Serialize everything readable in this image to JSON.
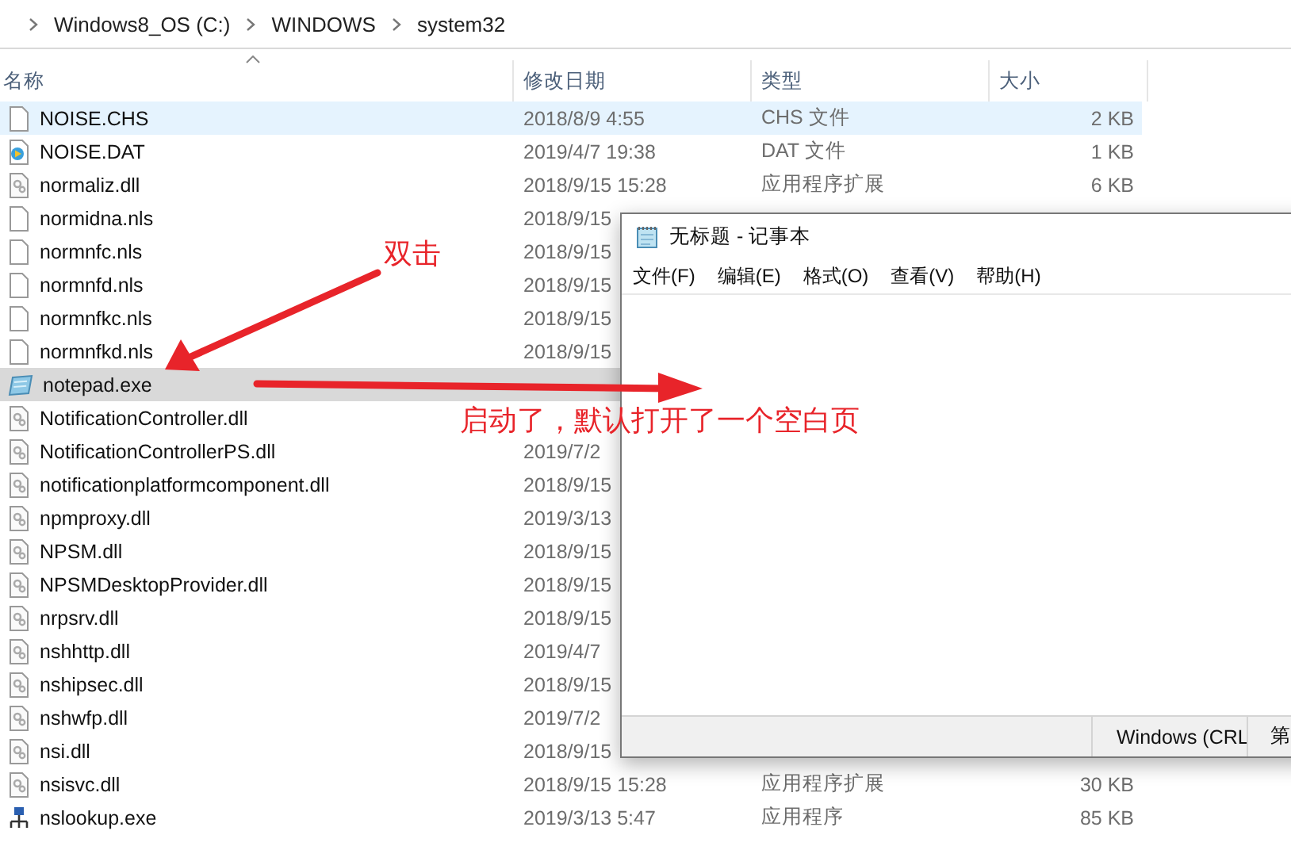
{
  "breadcrumb": [
    "Windows8_OS (C:)",
    "WINDOWS",
    "system32"
  ],
  "columns": [
    "名称",
    "修改日期",
    "类型",
    "大小"
  ],
  "rows": [
    {
      "kind": "text",
      "name": "NOISE.CHS",
      "date": "2018/8/9 4:55",
      "type": "CHS 文件",
      "size": "2 KB",
      "hovered": true,
      "selected": false
    },
    {
      "kind": "media",
      "name": "NOISE.DAT",
      "date": "2019/4/7 19:38",
      "type": "DAT 文件",
      "size": "1 KB",
      "hovered": false,
      "selected": false
    },
    {
      "kind": "dll",
      "name": "normaliz.dll",
      "date": "2018/9/15 15:28",
      "type": "应用程序扩展",
      "size": "6 KB",
      "hovered": false,
      "selected": false
    },
    {
      "kind": "text",
      "name": "normidna.nls",
      "date": "2018/9/15",
      "hovered": false,
      "selected": false
    },
    {
      "kind": "text",
      "name": "normnfc.nls",
      "date": "2018/9/15",
      "hovered": false,
      "selected": false
    },
    {
      "kind": "text",
      "name": "normnfd.nls",
      "date": "2018/9/15",
      "hovered": false,
      "selected": false
    },
    {
      "kind": "text",
      "name": "normnfkc.nls",
      "date": "2018/9/15",
      "hovered": false,
      "selected": false
    },
    {
      "kind": "text",
      "name": "normnfkd.nls",
      "date": "2018/9/15",
      "hovered": false,
      "selected": false
    },
    {
      "kind": "notepad",
      "name": "notepad.exe",
      "hovered": false,
      "selected": true
    },
    {
      "kind": "dll",
      "name": "NotificationController.dll",
      "hovered": false,
      "selected": false
    },
    {
      "kind": "dll",
      "name": "NotificationControllerPS.dll",
      "date": "2019/7/2",
      "hovered": false,
      "selected": false
    },
    {
      "kind": "dll",
      "name": "notificationplatformcomponent.dll",
      "date": "2018/9/15",
      "hovered": false,
      "selected": false
    },
    {
      "kind": "dll",
      "name": "npmproxy.dll",
      "date": "2019/3/13",
      "hovered": false,
      "selected": false
    },
    {
      "kind": "dll",
      "name": "NPSM.dll",
      "date": "2018/9/15",
      "hovered": false,
      "selected": false
    },
    {
      "kind": "dll",
      "name": "NPSMDesktopProvider.dll",
      "date": "2018/9/15",
      "hovered": false,
      "selected": false
    },
    {
      "kind": "dll",
      "name": "nrpsrv.dll",
      "date": "2018/9/15",
      "hovered": false,
      "selected": false
    },
    {
      "kind": "dll",
      "name": "nshhttp.dll",
      "date": "2019/4/7",
      "hovered": false,
      "selected": false
    },
    {
      "kind": "dll",
      "name": "nshipsec.dll",
      "date": "2018/9/15",
      "hovered": false,
      "selected": false
    },
    {
      "kind": "dll",
      "name": "nshwfp.dll",
      "date": "2019/7/2",
      "hovered": false,
      "selected": false
    },
    {
      "kind": "dll",
      "name": "nsi.dll",
      "date": "2018/9/15",
      "hovered": false,
      "selected": false
    },
    {
      "kind": "dll",
      "name": "nsisvc.dll",
      "date": "2018/9/15 15:28",
      "type": "应用程序扩展",
      "size": "30 KB",
      "hovered": false,
      "selected": false
    },
    {
      "kind": "network",
      "name": "nslookup.exe",
      "date": "2019/3/13 5:47",
      "type": "应用程序",
      "size": "85 KB",
      "hovered": false,
      "selected": false
    }
  ],
  "notepad": {
    "title": "无标题 - 记事本",
    "menu": [
      "文件(F)",
      "编辑(E)",
      "格式(O)",
      "查看(V)",
      "帮助(H)"
    ],
    "status": [
      "Windows (CRL",
      "第"
    ]
  },
  "annotations": [
    {
      "text": "双击"
    },
    {
      "text": "启动了，默认打开了一个空白页"
    }
  ]
}
